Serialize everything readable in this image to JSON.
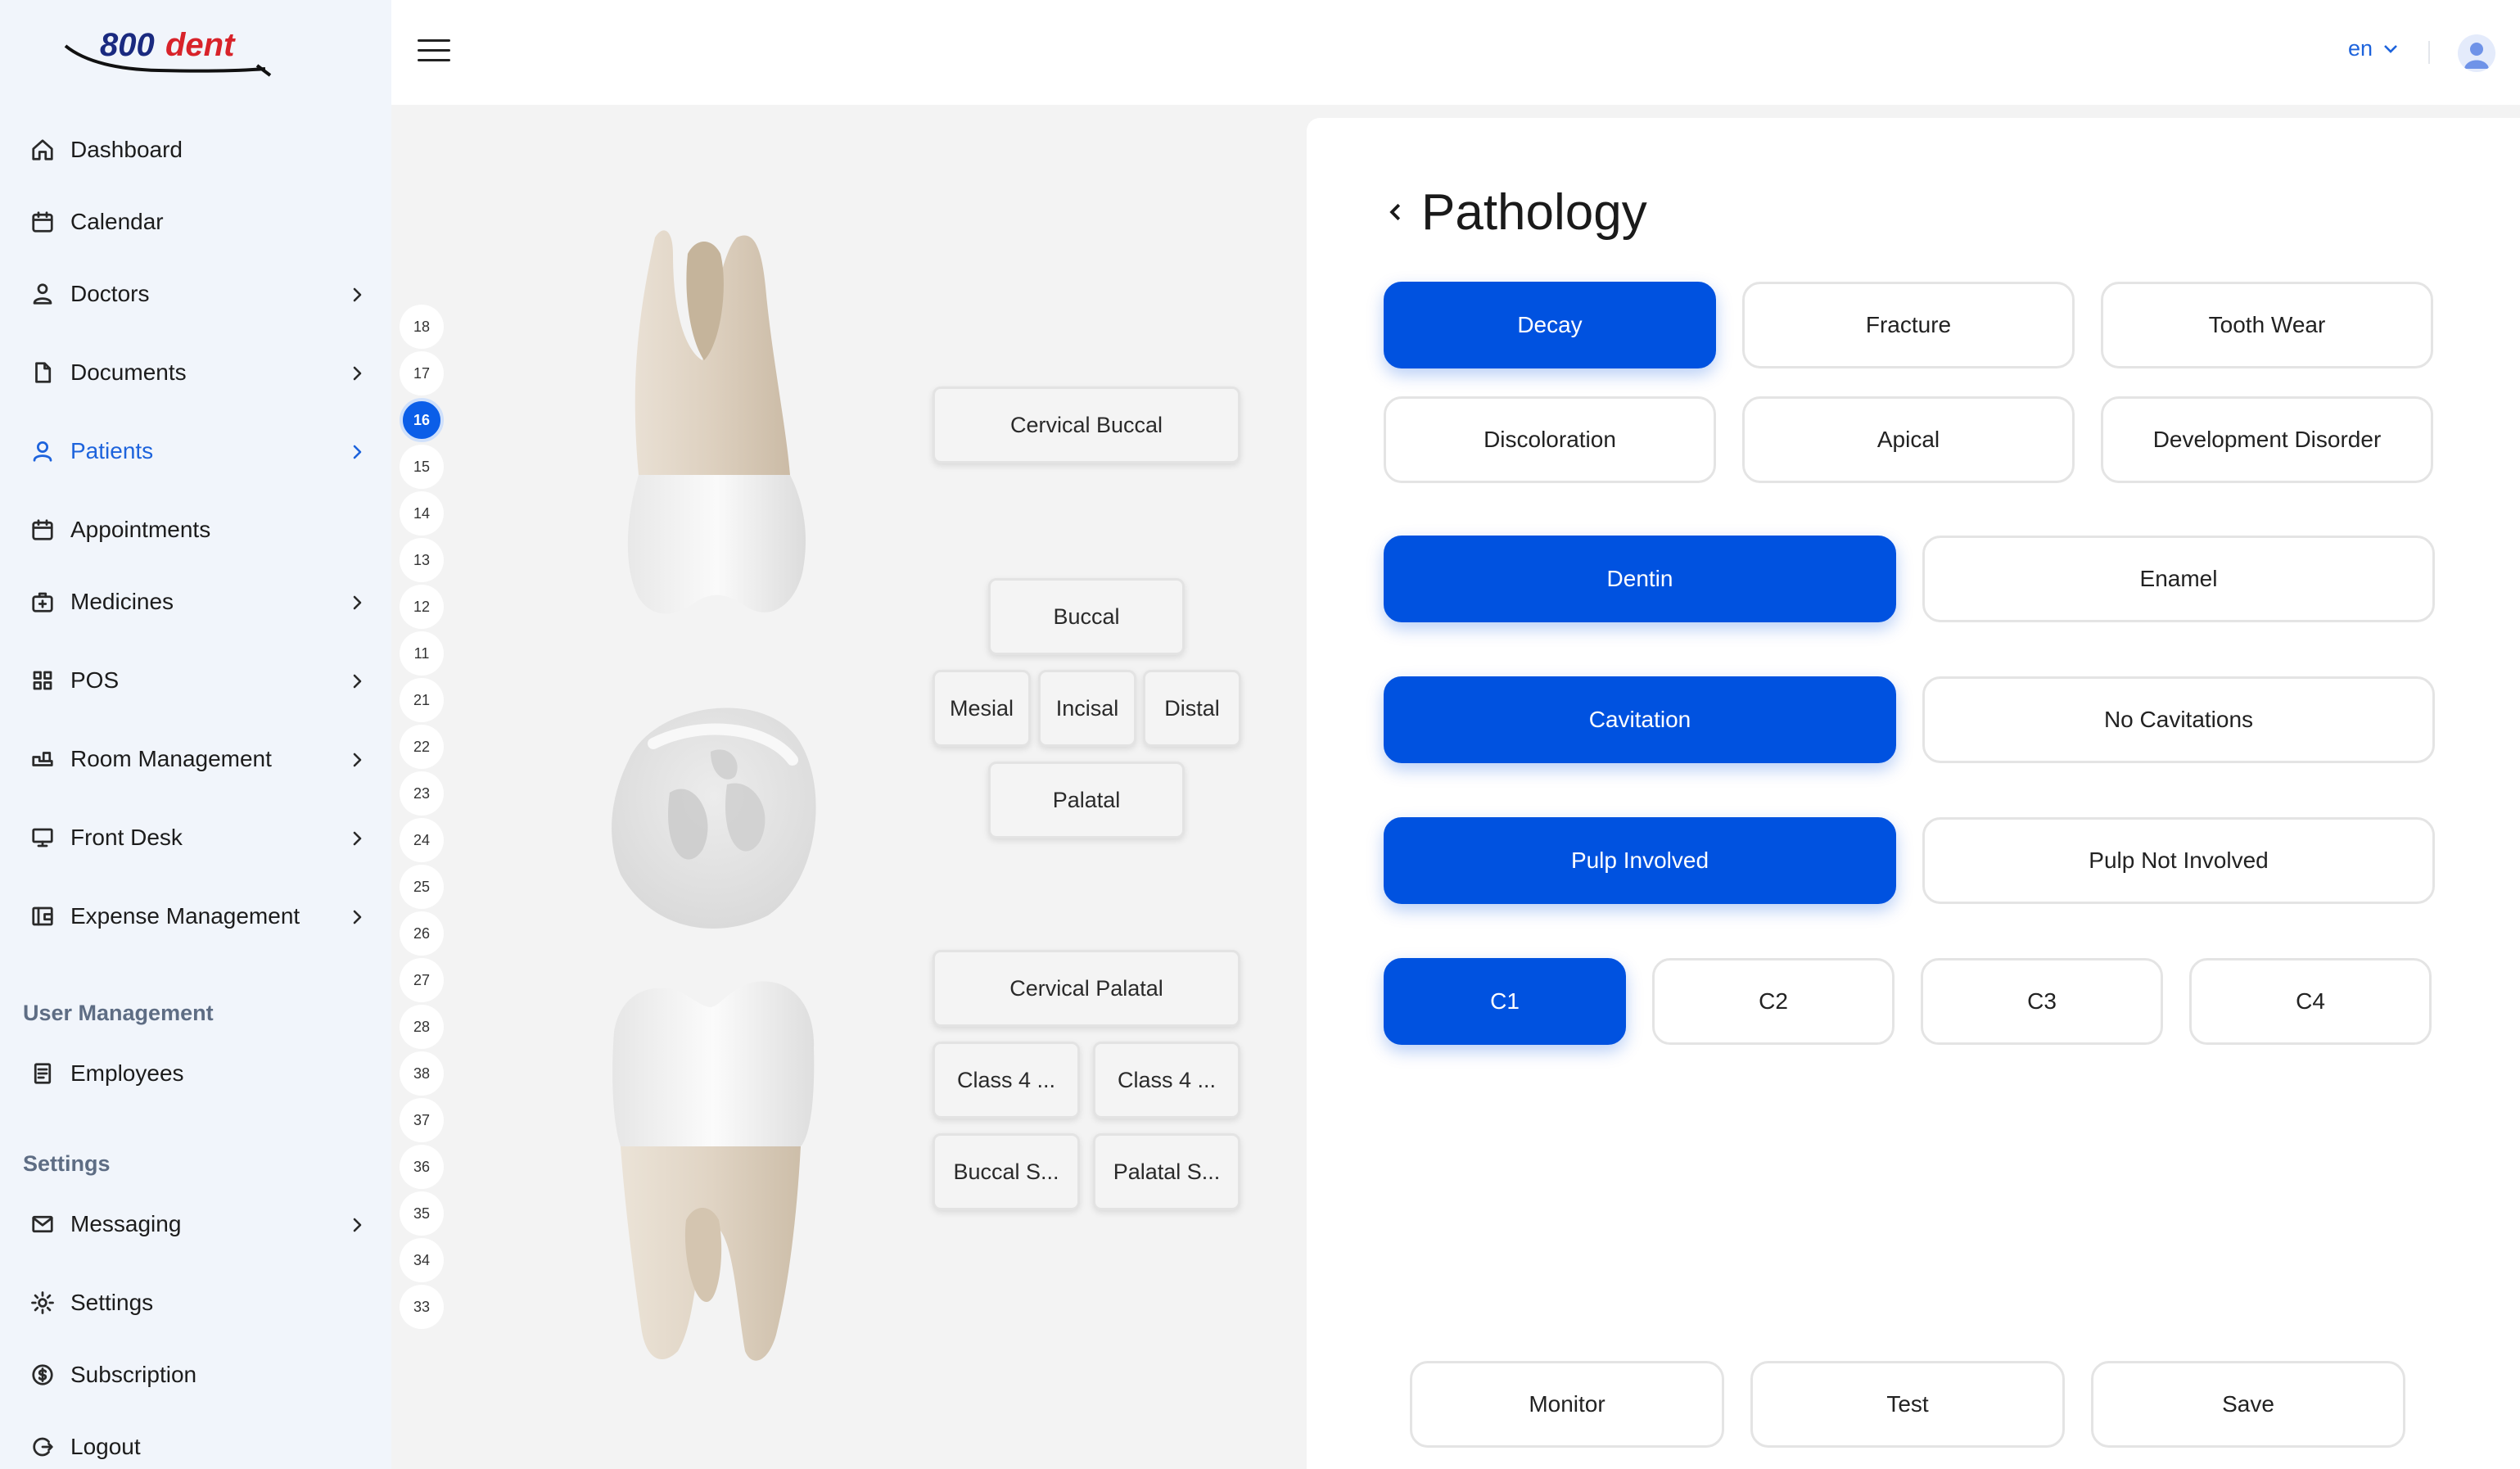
{
  "brand": {
    "logo_text": "800dent",
    "accent": "#0052e0"
  },
  "sidebar": {
    "items": [
      {
        "label": "Dashboard",
        "icon": "home-icon",
        "chevron": false
      },
      {
        "label": "Calendar",
        "icon": "calendar-icon",
        "chevron": false
      },
      {
        "label": "Doctors",
        "icon": "doctor-icon",
        "chevron": true
      },
      {
        "label": "Documents",
        "icon": "document-icon",
        "chevron": true
      },
      {
        "label": "Patients",
        "icon": "user-icon",
        "chevron": true,
        "active": true
      },
      {
        "label": "Appointments",
        "icon": "calendar-icon",
        "chevron": false
      },
      {
        "label": "Medicines",
        "icon": "medkit-icon",
        "chevron": true
      },
      {
        "label": "POS",
        "icon": "grid-icon",
        "chevron": true
      },
      {
        "label": "Room Management",
        "icon": "room-icon",
        "chevron": true
      },
      {
        "label": "Front Desk",
        "icon": "monitor-icon",
        "chevron": true
      },
      {
        "label": "Expense Management",
        "icon": "wallet-icon",
        "chevron": true
      }
    ],
    "section_user_management": "User Management",
    "user_items": [
      {
        "label": "Employees",
        "icon": "clipboard-icon"
      }
    ],
    "section_settings": "Settings",
    "settings_items": [
      {
        "label": "Messaging",
        "icon": "mail-icon",
        "chevron": true
      },
      {
        "label": "Settings",
        "icon": "gear-icon",
        "chevron": false
      },
      {
        "label": "Subscription",
        "icon": "dollar-icon",
        "chevron": false
      },
      {
        "label": "Logout",
        "icon": "logout-icon",
        "chevron": false
      }
    ]
  },
  "topbar": {
    "language": "en"
  },
  "tooth_numbers": [
    "18",
    "17",
    "16",
    "15",
    "14",
    "13",
    "12",
    "11",
    "21",
    "22",
    "23",
    "24",
    "25",
    "26",
    "27",
    "28",
    "38",
    "37",
    "36",
    "35",
    "34",
    "33"
  ],
  "selected_tooth": "16",
  "surfaces": {
    "cervical_buccal": "Cervical Buccal",
    "buccal": "Buccal",
    "mesial": "Mesial",
    "incisal": "Incisal",
    "distal": "Distal",
    "palatal": "Palatal",
    "cervical_palatal": "Cervical Palatal",
    "class4_a": "Class 4 ...",
    "class4_b": "Class 4 ...",
    "buccal_s": "Buccal S...",
    "palatal_s": "Palatal S..."
  },
  "panel": {
    "title": "Pathology",
    "pathology_types": [
      "Decay",
      "Fracture",
      "Tooth Wear",
      "Discoloration",
      "Apical",
      "Development Disorder"
    ],
    "selected_type": "Decay",
    "depth_options": [
      "Dentin",
      "Enamel"
    ],
    "cavitation_options": [
      "Cavitation",
      "No Cavitations"
    ],
    "pulp_options": [
      "Pulp Involved",
      "Pulp Not Involved"
    ],
    "class_options": [
      "C1",
      "C2",
      "C3",
      "C4"
    ],
    "actions": {
      "monitor": "Monitor",
      "test": "Test",
      "save": "Save"
    }
  }
}
